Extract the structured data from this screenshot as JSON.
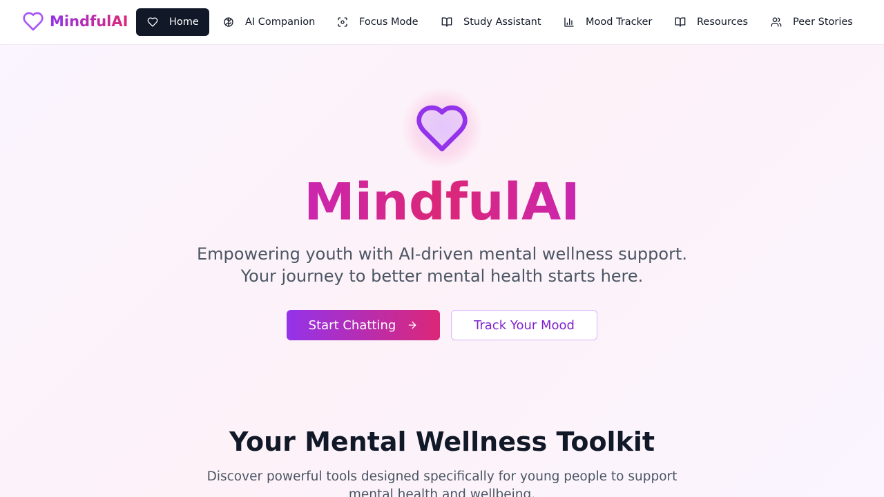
{
  "brand": {
    "name": "MindfulAI",
    "icon": "heart-icon"
  },
  "nav": {
    "items": [
      {
        "label": "Home",
        "icon": "heart-icon",
        "active": true
      },
      {
        "label": "AI Companion",
        "icon": "brain-icon"
      },
      {
        "label": "Focus Mode",
        "icon": "focus-icon"
      },
      {
        "label": "Study Assistant",
        "icon": "book-open-icon"
      },
      {
        "label": "Mood Tracker",
        "icon": "bar-chart-icon"
      },
      {
        "label": "Resources",
        "icon": "book-open-icon"
      },
      {
        "label": "Peer Stories",
        "icon": "users-icon"
      }
    ]
  },
  "hero": {
    "icon": "heart-icon",
    "title": "MindfulAI",
    "subtitle_line1": "Empowering youth with AI-driven mental wellness support.",
    "subtitle_line2": "Your journey to better mental health starts here.",
    "primary_button": "Start Chatting",
    "secondary_button": "Track Your Mood"
  },
  "toolkit": {
    "title": "Your Mental Wellness Toolkit",
    "subtitle": "Discover powerful tools designed specifically for young people to support mental health and wellbeing."
  },
  "colors": {
    "accent_purple": "#9333ea",
    "accent_pink": "#db2777",
    "nav_active_bg": "#111827",
    "outline_border": "#d8b4fe"
  }
}
